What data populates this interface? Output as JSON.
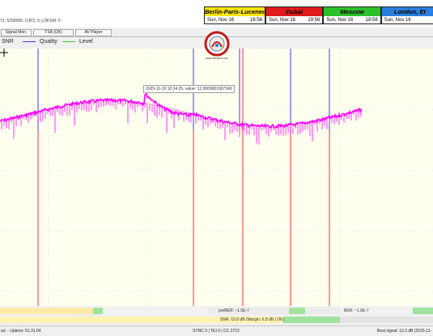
{
  "window": {
    "params_line": "71: 5150000, LOF2: 0, LOFSW: 0"
  },
  "clocks": [
    {
      "city": "Berlin-Paris-Lucenec",
      "date": "Sun, Nov 16",
      "time": "16:56",
      "color": "#ffe600"
    },
    {
      "city": "Dubai",
      "date": "Sun, Nov 16",
      "time": "19:56",
      "color": "#e01b1b"
    },
    {
      "city": "Moscow",
      "date": "Sun, Nov 16",
      "time": "18:56",
      "color": "#2bc12b"
    },
    {
      "city": "London, Et",
      "date": "Sun, Nov 16",
      "time": "",
      "color": "#2a7fe0"
    }
  ],
  "tabs": [
    {
      "label": "Signal Mon."
    },
    {
      "label": "TSA (OK)"
    },
    {
      "label": "AV Player"
    }
  ],
  "legend": [
    {
      "label": "SNR",
      "color": "#ff00ff"
    },
    {
      "label": "Quality",
      "color": "#3a3aff"
    },
    {
      "label": "Level",
      "color": "#33cc33"
    }
  ],
  "logo_text": "www.dxsatcs.com",
  "tooltip": "2025-11-15 10:34:25, value: 12,3000001907349",
  "ber_strip": {
    "label_left": "preBER: ~1.0E-7",
    "label_right": "BER: ~1.0E-7"
  },
  "snr_strip": {
    "label": "SNR: 10,8 dB (Margin: 6,8 dB | OK)"
  },
  "status": {
    "left": "ed. - Uptime: 51:31:04",
    "middle": "SYNC 0 | TEI 0 | CC 3712",
    "right": "Best signal: 12,3 dB (2025-11-"
  },
  "chart_data": {
    "type": "line",
    "series": [
      {
        "name": "SNR",
        "color": "#ff00ff"
      },
      {
        "name": "Quality",
        "color": "#3a3aff"
      },
      {
        "name": "Level",
        "color": "#33cc33"
      }
    ],
    "grid": true
  }
}
